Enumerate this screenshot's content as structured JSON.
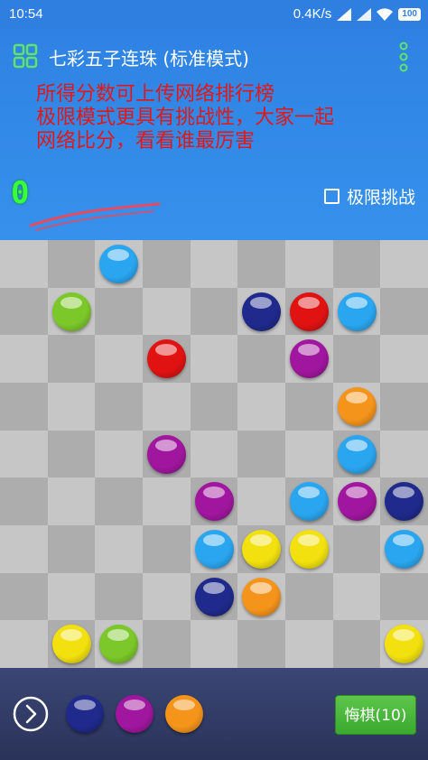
{
  "status_bar": {
    "time": "10:54",
    "network_speed": "0.4K/s",
    "battery": "100"
  },
  "app": {
    "title": "七彩五子连珠 (标准模式)"
  },
  "notice": {
    "lines": [
      "所得分数可上传网络排行榜",
      "极限模式更具有挑战性，大家一起",
      "网络比分，看看谁最厉害"
    ],
    "color": "#e01818"
  },
  "score": "0",
  "extreme_mode": {
    "label": "极限挑战",
    "checked": false
  },
  "colors": {
    "blue": "#2aa6f0",
    "green": "#7cc82a",
    "navy": "#1f2a8c",
    "red": "#e01212",
    "purple": "#a0169e",
    "orange": "#f5941a",
    "yellow": "#f2e10e"
  },
  "board": {
    "size": 9,
    "balls": [
      {
        "row": 0,
        "col": 2,
        "color": "blue"
      },
      {
        "row": 1,
        "col": 1,
        "color": "green"
      },
      {
        "row": 1,
        "col": 5,
        "color": "navy"
      },
      {
        "row": 1,
        "col": 6,
        "color": "red"
      },
      {
        "row": 1,
        "col": 7,
        "color": "blue"
      },
      {
        "row": 2,
        "col": 3,
        "color": "red"
      },
      {
        "row": 2,
        "col": 6,
        "color": "purple"
      },
      {
        "row": 3,
        "col": 7,
        "color": "orange"
      },
      {
        "row": 4,
        "col": 3,
        "color": "purple"
      },
      {
        "row": 4,
        "col": 7,
        "color": "blue"
      },
      {
        "row": 5,
        "col": 4,
        "color": "purple"
      },
      {
        "row": 5,
        "col": 6,
        "color": "blue"
      },
      {
        "row": 5,
        "col": 7,
        "color": "purple"
      },
      {
        "row": 5,
        "col": 8,
        "color": "navy"
      },
      {
        "row": 6,
        "col": 4,
        "color": "blue"
      },
      {
        "row": 6,
        "col": 5,
        "color": "yellow"
      },
      {
        "row": 6,
        "col": 6,
        "color": "yellow"
      },
      {
        "row": 6,
        "col": 8,
        "color": "blue"
      },
      {
        "row": 7,
        "col": 4,
        "color": "navy"
      },
      {
        "row": 7,
        "col": 5,
        "color": "orange"
      },
      {
        "row": 8,
        "col": 1,
        "color": "yellow"
      },
      {
        "row": 8,
        "col": 2,
        "color": "green"
      },
      {
        "row": 8,
        "col": 8,
        "color": "yellow"
      }
    ]
  },
  "next_balls": [
    "navy",
    "purple",
    "orange"
  ],
  "undo_button": {
    "label": "悔棋(10)"
  }
}
